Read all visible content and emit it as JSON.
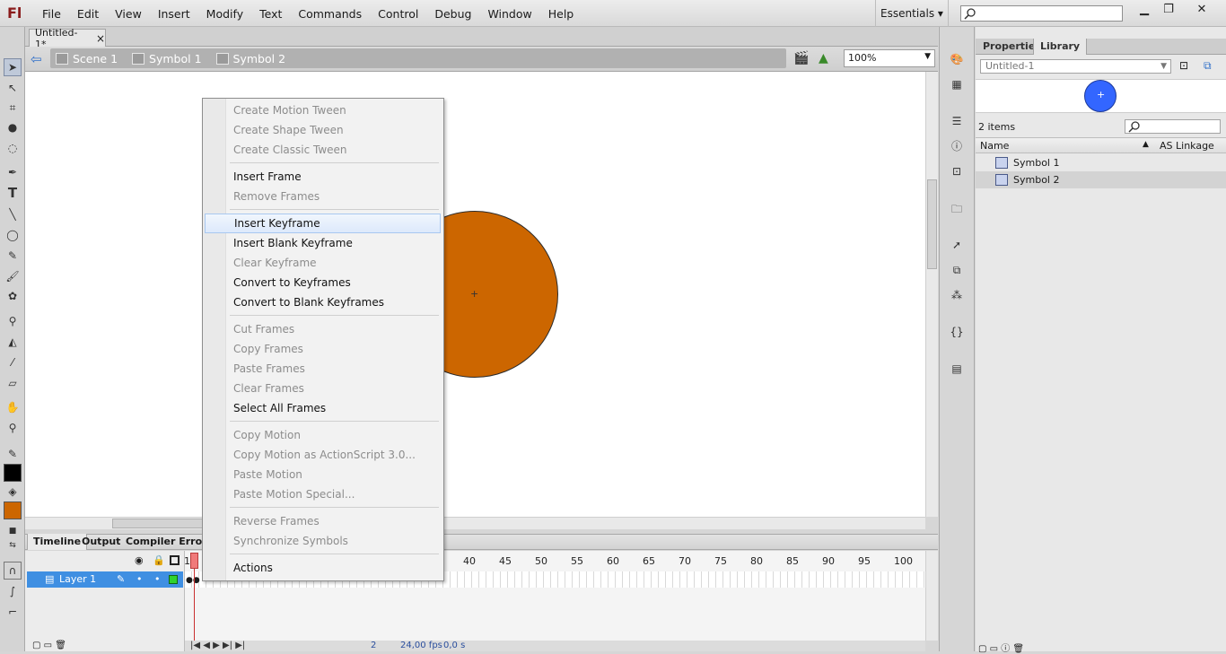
{
  "app": {
    "logo": "Fl",
    "workspace": "Essentials ▾"
  },
  "menu": [
    "File",
    "Edit",
    "View",
    "Insert",
    "Modify",
    "Text",
    "Commands",
    "Control",
    "Debug",
    "Window",
    "Help"
  ],
  "window_controls": {
    "minimize": "▁",
    "restore": "❐",
    "close": "✕"
  },
  "document": {
    "tab": "Untitled-1*",
    "tab_close": "×"
  },
  "breadcrumb": {
    "scene": "Scene 1",
    "symbol1": "Symbol 1",
    "symbol2": "Symbol 2"
  },
  "zoom": {
    "value": "100%"
  },
  "context_menu": [
    {
      "label": "Create Motion Tween",
      "enabled": false
    },
    {
      "label": "Create Shape Tween",
      "enabled": false
    },
    {
      "label": "Create Classic Tween",
      "enabled": false
    },
    {
      "label": "Insert Frame",
      "enabled": true
    },
    {
      "label": "Remove Frames",
      "enabled": false
    },
    {
      "label": "Insert Keyframe",
      "enabled": true,
      "highlighted": true
    },
    {
      "label": "Insert Blank Keyframe",
      "enabled": true
    },
    {
      "label": "Clear Keyframe",
      "enabled": false
    },
    {
      "label": "Convert to Keyframes",
      "enabled": true
    },
    {
      "label": "Convert to Blank Keyframes",
      "enabled": true
    },
    {
      "label": "Cut Frames",
      "enabled": false
    },
    {
      "label": "Copy Frames",
      "enabled": false
    },
    {
      "label": "Paste Frames",
      "enabled": false
    },
    {
      "label": "Clear Frames",
      "enabled": false
    },
    {
      "label": "Select All Frames",
      "enabled": true
    },
    {
      "label": "Copy Motion",
      "enabled": false
    },
    {
      "label": "Copy Motion as ActionScript 3.0...",
      "enabled": false
    },
    {
      "label": "Paste Motion",
      "enabled": false
    },
    {
      "label": "Paste Motion Special...",
      "enabled": false
    },
    {
      "label": "Reverse Frames",
      "enabled": false
    },
    {
      "label": "Synchronize Symbols",
      "enabled": false
    },
    {
      "label": "Actions",
      "enabled": true
    }
  ],
  "timeline": {
    "tabs": [
      "Timeline",
      "Output",
      "Compiler Errors"
    ],
    "layer_name": "Layer 1",
    "frame_one": "1",
    "frame_numbers": [
      "40",
      "45",
      "50",
      "55",
      "60",
      "65",
      "70",
      "75",
      "80",
      "85",
      "90",
      "95",
      "100"
    ],
    "status": {
      "frame": "2",
      "fps": "24,00 fps",
      "time": "0,0 s"
    }
  },
  "panel": {
    "tabs": [
      "Properties",
      "Library"
    ],
    "library_doc": "Untitled-1",
    "item_count": "2 items",
    "col_name": "Name",
    "col_linkage": "AS Linkage",
    "items": [
      "Symbol 1",
      "Symbol 2"
    ]
  },
  "colors": {
    "stage_circle": "#cc6600",
    "preview_circle": "#3366ff",
    "stroke_swatch": "#000000",
    "fill_swatch": "#cc6600",
    "selection": "#3f8fe2"
  }
}
